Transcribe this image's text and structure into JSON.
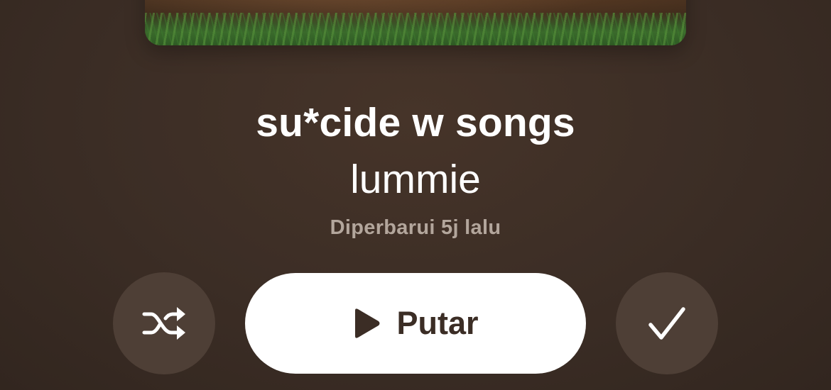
{
  "playlist": {
    "title": "su*cide w songs",
    "creator": "lummie",
    "updated_text": "Diperbarui 5j lalu"
  },
  "controls": {
    "shuffle_icon": "shuffle-icon",
    "play_icon": "play-icon",
    "play_label": "Putar",
    "added_icon": "checkmark-icon"
  },
  "colors": {
    "background": "#3b2d25",
    "round_button": "#4e3f36",
    "play_button": "#ffffff",
    "play_text": "#3b2d25",
    "secondary_text": "#b3a69c"
  }
}
